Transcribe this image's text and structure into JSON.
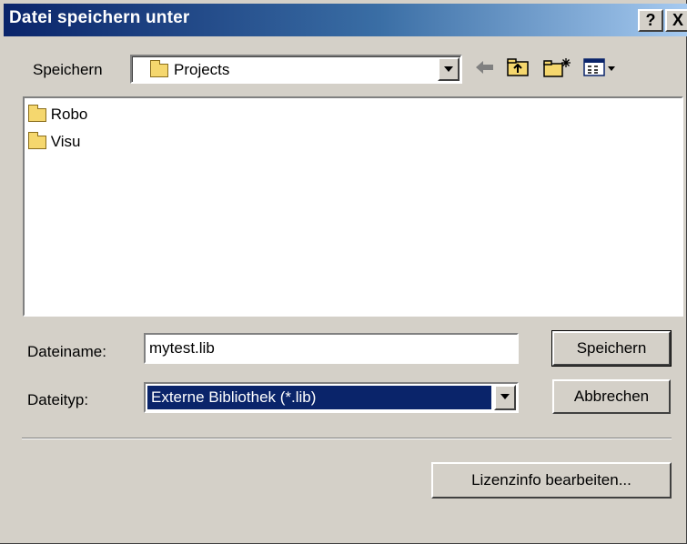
{
  "window": {
    "title": "Datei speichern unter",
    "help_button": "?",
    "close_button": "X"
  },
  "save_in": {
    "label": "Speichern",
    "value": "Projects"
  },
  "toolbar": {
    "icons": [
      "back-arrow-icon",
      "up-folder-icon",
      "new-folder-icon",
      "view-menu-icon"
    ]
  },
  "file_list": {
    "items": [
      {
        "name": "Robo",
        "icon": "folder-icon"
      },
      {
        "name": "Visu",
        "icon": "folder-icon"
      }
    ]
  },
  "filename": {
    "label": "Dateiname:",
    "value": "mytest.lib"
  },
  "filetype": {
    "label": "Dateityp:",
    "value": "Externe Bibliothek (*.lib)"
  },
  "buttons": {
    "save": "Speichern",
    "cancel": "Abbrechen",
    "license": "Lizenzinfo bearbeiten..."
  },
  "colors": {
    "title_gradient_start": "#0a246a",
    "title_gradient_end": "#a6caf0",
    "selection": "#0a246a",
    "dialog_face": "#d4d0c8"
  }
}
